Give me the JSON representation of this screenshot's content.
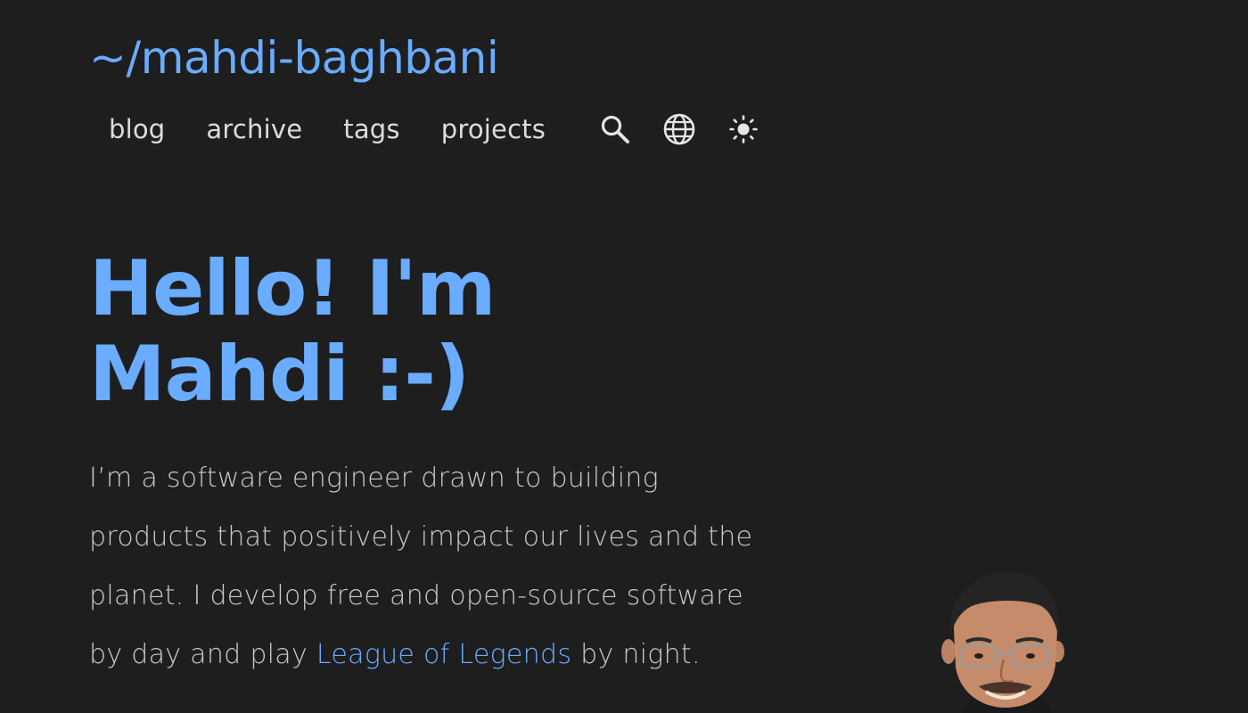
{
  "site": {
    "title": "~/mahdi-baghbani"
  },
  "nav": {
    "links": [
      {
        "label": "blog"
      },
      {
        "label": "archive"
      },
      {
        "label": "tags"
      },
      {
        "label": "projects"
      }
    ],
    "icons": [
      "search-icon",
      "globe-icon",
      "sun-icon"
    ]
  },
  "hero": {
    "headline": "Hello! I'm Mahdi :-)",
    "bio_part1": "I’m a software engineer drawn to building products that positively impact our lives and the planet. I develop free and open-source software by day and play ",
    "bio_link": "League of Legends",
    "bio_part2": " by night."
  },
  "colors": {
    "background": "#1e1e1f",
    "accent": "#6aacff",
    "text": "#c9c9c9",
    "nav_text": "#dcdcdc"
  }
}
